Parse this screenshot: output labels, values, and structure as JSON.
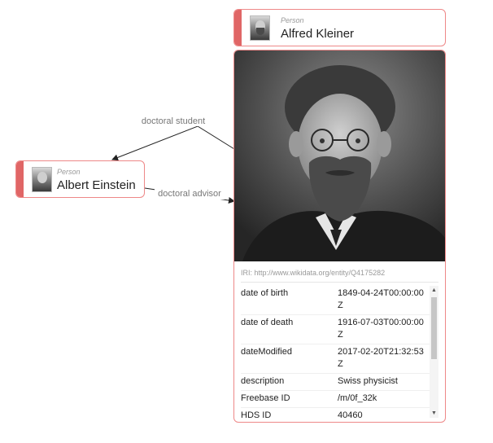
{
  "nodes": {
    "einstein": {
      "type": "Person",
      "name": "Albert Einstein"
    },
    "kleiner": {
      "type": "Person",
      "name": "Alfred Kleiner",
      "iri": "IRI: http://www.wikidata.org/entity/Q4175282",
      "properties": [
        {
          "key": "date of birth",
          "value": "1849-04-24T00:00:00Z"
        },
        {
          "key": "date of death",
          "value": "1916-07-03T00:00:00Z"
        },
        {
          "key": "dateModified",
          "value": "2017-02-20T21:32:53Z"
        },
        {
          "key": "description",
          "value": "Swiss physicist"
        },
        {
          "key": "Freebase ID",
          "value": "/m/0f_32k"
        },
        {
          "key": "HDS ID",
          "value": "40460"
        }
      ]
    }
  },
  "edges": {
    "doctoral_student": "doctoral student",
    "doctoral_advisor": "doctoral advisor"
  },
  "icons": {
    "scroll_up": "▲",
    "scroll_down": "▼"
  },
  "colors": {
    "accent": "#e06666",
    "border": "#ee8888"
  }
}
